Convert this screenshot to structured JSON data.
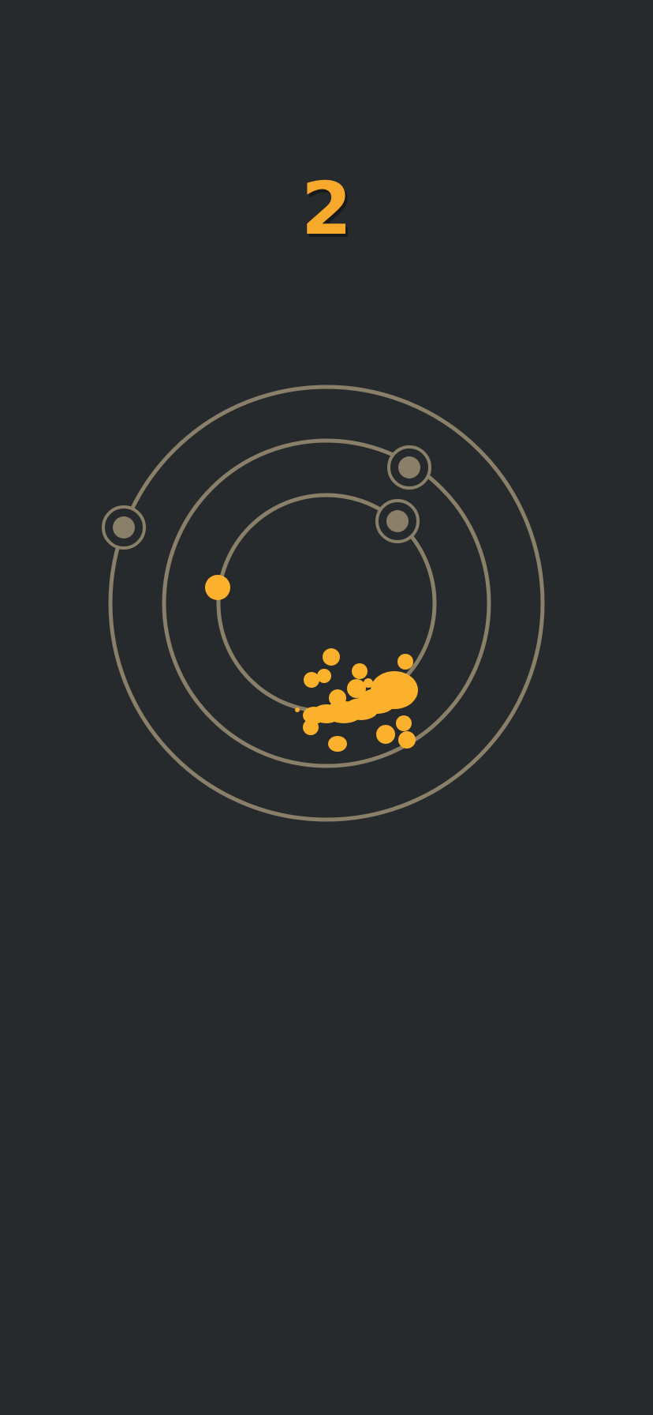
{
  "game": {
    "score": "2",
    "orbit_count": 3,
    "blocker_count": 3,
    "player_orbit": "inner",
    "colors": {
      "background": "#272a2d",
      "orbit": "#8a7f69",
      "blocker_fill": "#8a7f69",
      "player": "#fbb12c",
      "splat": "#fbb12c"
    },
    "icons": {
      "player": "player-ball-icon",
      "blocker": "blocker-node-icon",
      "splat": "splat-particles-icon"
    }
  }
}
